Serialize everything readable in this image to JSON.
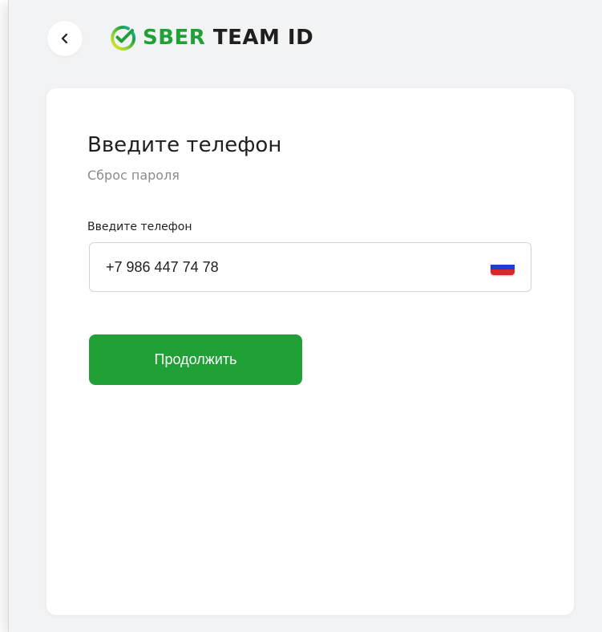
{
  "header": {
    "back_icon": "chevron-left-icon",
    "logo": {
      "brand": "SBER",
      "product": "TEAM ID",
      "icon": "sber-checkmark-logo-icon"
    }
  },
  "form": {
    "title": "Введите телефон",
    "subtitle": "Сброс пароля",
    "phone_label": "Введите телефон",
    "phone_value": "+7 986 447 74 78",
    "country_flag_icon": "russia-flag-icon",
    "submit_label": "Продолжить"
  },
  "colors": {
    "brand_green": "#21a038",
    "page_background": "#f2f3f4",
    "card_background": "#ffffff",
    "input_border": "#d3d5d8",
    "subtitle_gray": "#8a8b8e"
  }
}
